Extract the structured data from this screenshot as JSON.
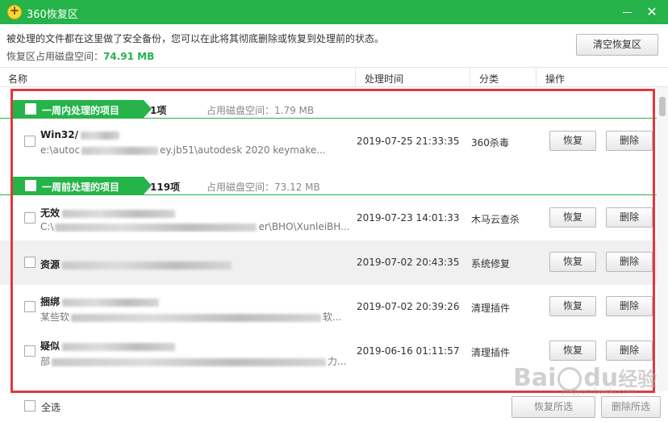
{
  "window": {
    "title": "360恢复区",
    "close_glyph": "✕"
  },
  "info": {
    "line1": "被处理的文件都在这里做了安全备份，您可以在此将其彻底删除或恢复到处理前的状态。",
    "space_label": "恢复区占用磁盘空间：",
    "space_value": "74.91 MB"
  },
  "toolbar": {
    "clear_label": "清空恢复区"
  },
  "columns": {
    "name": "名称",
    "time": "处理时间",
    "category": "分类",
    "action": "操作"
  },
  "groups": [
    {
      "title": "一周内处理的项目",
      "count": "1项",
      "size": "占用磁盘空间：1.79 MB"
    },
    {
      "title": "一周前处理的项目",
      "count": "119项",
      "size": "占用磁盘空间：73.12 MB"
    }
  ],
  "rows": [
    {
      "name": "Win32/",
      "path": "e:\\autoc",
      "path_tail": "ey.jb51\\autodesk 2020 keymake...",
      "time": "2019-07-25 21:33:35",
      "category": "360杀毒",
      "restore": "恢复",
      "delete": "删除"
    },
    {
      "name": "无效",
      "path": "C:\\",
      "path_tail": "er\\BHO\\XunleiBH...",
      "time": "2019-07-23 14:01:33",
      "category": "木马云查杀",
      "restore": "恢复",
      "delete": "删除"
    },
    {
      "name": "资源",
      "path": "",
      "path_tail": "",
      "time": "2019-07-02 20:43:35",
      "category": "系统修复",
      "restore": "恢复",
      "delete": "删除"
    },
    {
      "name": "捆绑",
      "path": "某些软",
      "path_tail": "软...",
      "time": "2019-07-02 20:39:26",
      "category": "清理插件",
      "restore": "恢复",
      "delete": "删除"
    },
    {
      "name": "疑似",
      "path": "部",
      "path_tail": "力...",
      "time": "2019-06-16 01:11:57",
      "category": "清理插件",
      "restore": "恢复",
      "delete": "删除"
    }
  ],
  "footer": {
    "select_all": "全选",
    "restore_selected": "恢复所选",
    "delete_selected": "删除所选"
  },
  "watermark": {
    "text_a": "Bai",
    "text_b": "du",
    "text_c": "经验",
    "text_d": "jingyan.baidu.com"
  },
  "colors": {
    "brand": "#25b34a",
    "highlight": "#e0393e"
  }
}
